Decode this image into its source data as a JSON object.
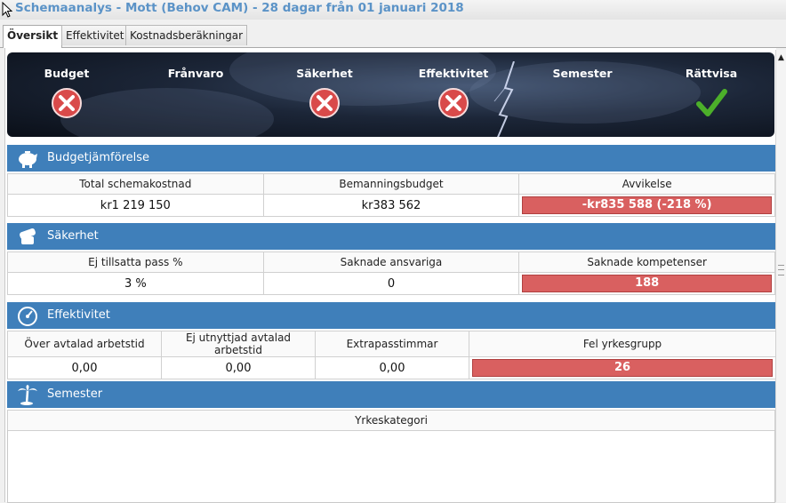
{
  "window": {
    "title": "Schemaanalys - Mott (Behov CAM) - 28 dagar från 01 januari 2018"
  },
  "tabs": [
    {
      "label": "Översikt",
      "active": true
    },
    {
      "label": "Effektivitet",
      "active": false
    },
    {
      "label": "Kostnadsberäkningar",
      "active": false
    }
  ],
  "banner": {
    "items": [
      {
        "label": "Budget",
        "status": "fail"
      },
      {
        "label": "Frånvaro",
        "status": "none"
      },
      {
        "label": "Säkerhet",
        "status": "fail"
      },
      {
        "label": "Effektivitet",
        "status": "fail"
      },
      {
        "label": "Semester",
        "status": "none"
      },
      {
        "label": "Rättvisa",
        "status": "pass"
      }
    ]
  },
  "budget": {
    "title": "Budgetjämförelse",
    "icon": "piggy-bank-icon",
    "headers": [
      "Total schemakostnad",
      "Bemanningsbudget",
      "Avvikelse"
    ],
    "values": [
      "kr1 219 150",
      "kr383 562",
      "-kr835 588 (-218 %)"
    ]
  },
  "safety": {
    "title": "Säkerhet",
    "icon": "bandage-icon",
    "headers": [
      "Ej tillsatta pass %",
      "Saknade ansvariga",
      "Saknade kompetenser"
    ],
    "values": [
      "3 %",
      "0",
      "188"
    ]
  },
  "efficiency": {
    "title": "Effektivitet",
    "icon": "gauge-icon",
    "headers": [
      "Över avtalad arbetstid",
      "Ej utnyttjad avtalad arbetstid",
      "Extrapasstimmar",
      "Fel yrkesgrupp"
    ],
    "values": [
      "0,00",
      "0,00",
      "0,00",
      "26"
    ]
  },
  "vacation": {
    "title": "Semester",
    "icon": "palm-tree-icon",
    "headers": [
      "Yrkeskategori"
    ]
  },
  "colors": {
    "accent": "#3f7fba",
    "alert": "#d96060",
    "ok": "#4caf2a",
    "fail": "#d94a4a"
  }
}
